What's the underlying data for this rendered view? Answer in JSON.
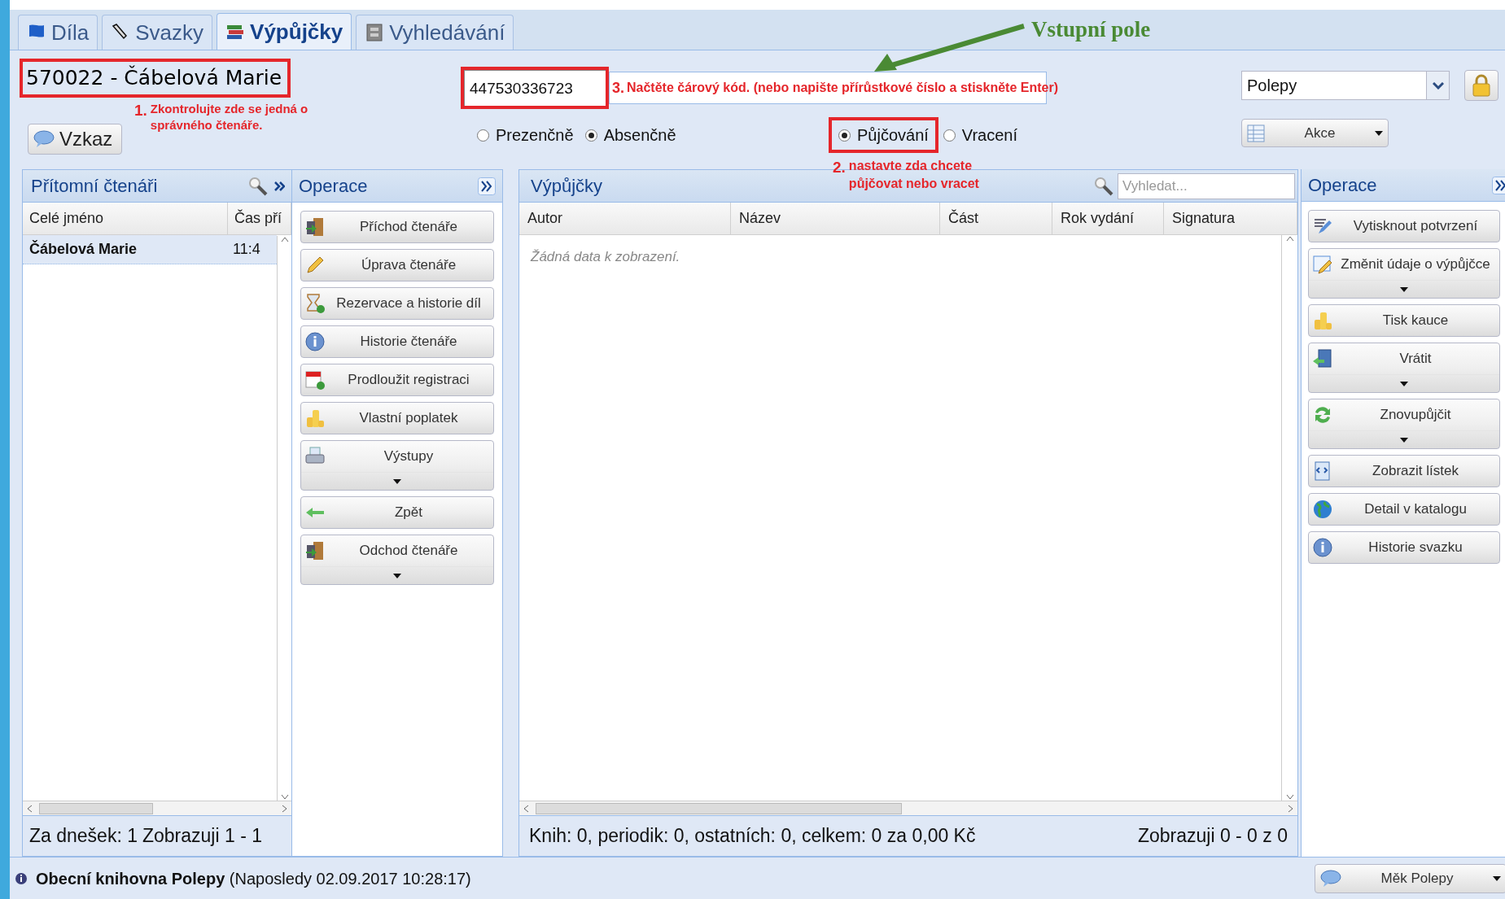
{
  "tabs": [
    {
      "label": "Díla",
      "selected": false
    },
    {
      "label": "Svazky",
      "selected": false
    },
    {
      "label": "Výpůjčky",
      "selected": true
    },
    {
      "label": "Vyhledávání",
      "selected": false
    }
  ],
  "callout": "Vstupní pole",
  "reader_title": "570022 - Čábelová Marie",
  "step_1": {
    "number": "1.",
    "text": "Zkontrolujte zde se jedná o správného čtenáře."
  },
  "message_button": "Vzkaz",
  "barcode_field": {
    "value": "447530336723"
  },
  "step_3": {
    "number": "3.",
    "text": "Načtěte čárový kód. (nebo napište přírůstkové číslo a stiskněte Enter)"
  },
  "loan_type": [
    {
      "label": "Prezenčně",
      "selected": false
    },
    {
      "label": "Absenčně",
      "selected": true
    }
  ],
  "mode": [
    {
      "label": "Půjčování",
      "selected": true
    },
    {
      "label": "Vracení",
      "selected": false
    }
  ],
  "step_2": {
    "number": "2.",
    "text": "nastavte zda chcete půjčovat nebo vracet"
  },
  "location_select": {
    "value": "Polepy"
  },
  "actions_button": "Akce",
  "readers_panel": {
    "title": "Přítomní čtenáři",
    "columns": [
      "Celé jméno",
      "Čas pří"
    ],
    "rows": [
      {
        "cells": [
          "Čábelová Marie",
          "11:4"
        ],
        "selected": true
      }
    ],
    "footer": [
      "Za dnešek: 1",
      "Zobrazuji 1 - 1"
    ]
  },
  "operations_left": {
    "title": "Operace",
    "buttons": [
      {
        "label": "Příchod čtenáře",
        "dropdown": false
      },
      {
        "label": "Úprava čtenáře",
        "dropdown": false
      },
      {
        "label": "Rezervace a historie díl",
        "dropdown": false
      },
      {
        "label": "Historie čtenáře",
        "dropdown": false
      },
      {
        "label": "Prodloužit registraci",
        "dropdown": false
      },
      {
        "label": "Vlastní poplatek",
        "dropdown": false
      },
      {
        "label": "Výstupy",
        "dropdown": true
      },
      {
        "label": "Zpět",
        "dropdown": false
      },
      {
        "label": "Odchod čtenáře",
        "dropdown": true
      }
    ]
  },
  "loans_panel": {
    "title": "Výpůjčky",
    "search": {
      "placeholder": "Vyhledat..."
    },
    "columns": [
      "Autor",
      "Název",
      "Část",
      "Rok vydání",
      "Signatura"
    ],
    "empty_text": "Žádná data k zobrazení.",
    "footer_left": "Knih: 0, periodik: 0, ostatních: 0, celkem: 0 za 0,00 Kč",
    "footer_right": "Zobrazuji 0 - 0 z 0"
  },
  "operations_right": {
    "title": "Operace",
    "buttons": [
      {
        "label": "Vytisknout potvrzení",
        "dropdown": false
      },
      {
        "label": "Změnit údaje o výpůjčce",
        "dropdown": true
      },
      {
        "label": "Tisk kauce",
        "dropdown": false
      },
      {
        "label": "Vrátit",
        "dropdown": true
      },
      {
        "label": "Znovupůjčit",
        "dropdown": true
      },
      {
        "label": "Zobrazit lístek",
        "dropdown": false
      },
      {
        "label": "Detail v katalogu",
        "dropdown": false
      },
      {
        "label": "Historie svazku",
        "dropdown": false
      }
    ]
  },
  "status_bar": {
    "library": "Obecní knihovna Polepy",
    "last_login": "(Naposledy 02.09.2017 10:28:17)",
    "user_button": "Měk Polepy"
  }
}
